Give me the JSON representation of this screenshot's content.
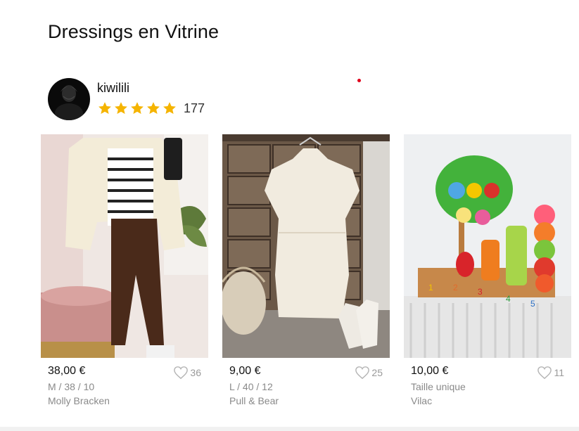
{
  "section": {
    "title": "Dressings en Vitrine"
  },
  "seller": {
    "username": "kiwilili",
    "rating_stars": 5,
    "rating_count": "177",
    "star_color": "#f5b400"
  },
  "items": [
    {
      "price": "38,00 €",
      "favorites": "36",
      "size": "M / 38 / 10",
      "brand": "Molly Bracken"
    },
    {
      "price": "9,00 €",
      "favorites": "25",
      "size": "L / 40 / 12",
      "brand": "Pull & Bear"
    },
    {
      "price": "10,00 €",
      "favorites": "11",
      "size": "Taille unique",
      "brand": "Vilac"
    }
  ],
  "icons": {
    "favorite": "heart-outline-icon",
    "rating": "star-icon"
  },
  "colors": {
    "accent_dot": "#e0001b",
    "muted_text": "#8a8a8a"
  }
}
